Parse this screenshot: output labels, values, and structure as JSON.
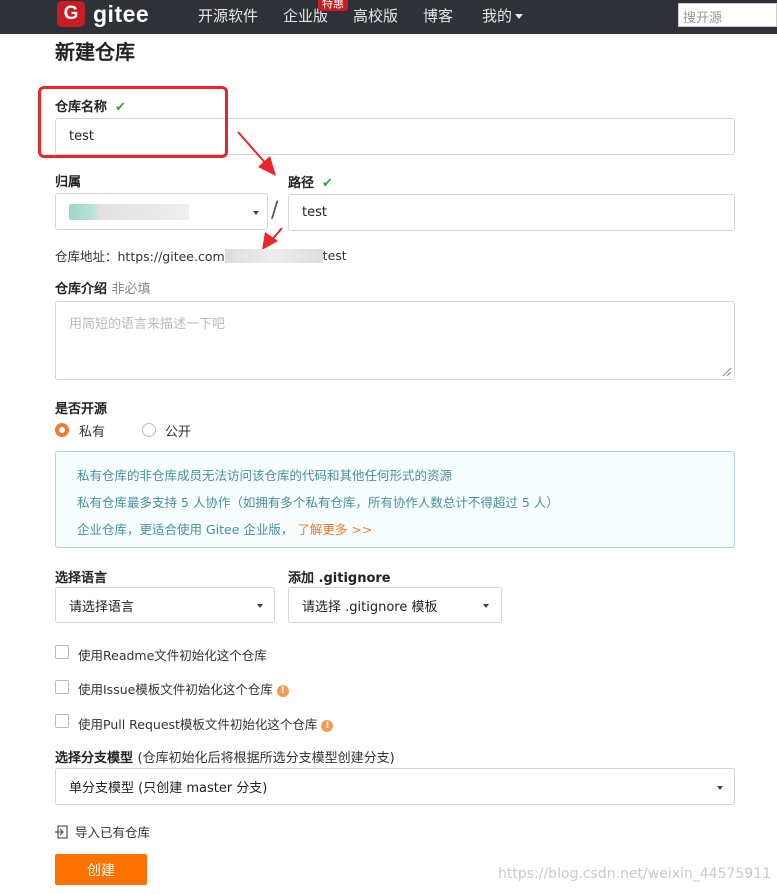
{
  "nav": {
    "logo_mark": "G",
    "logo_text": "gitee",
    "items": [
      "开源软件",
      "企业版",
      "高校版",
      "博客",
      "我的"
    ],
    "hot_badge": "特惠",
    "search_placeholder": "搜开源"
  },
  "page": {
    "title": "新建仓库",
    "repo_name_label": "仓库名称",
    "repo_name_value": "test",
    "owner_label": "归属",
    "path_label": "路径",
    "path_value": "test",
    "slash": "/",
    "address_prefix": "仓库地址：https://gitee.com",
    "address_suffix": "test",
    "intro_label": "仓库介绍",
    "intro_optional": "非必填",
    "intro_placeholder": "用简短的语言来描述一下吧",
    "open_label": "是否开源",
    "radio_private": "私有",
    "radio_public": "公开",
    "info_lines": [
      "私有仓库的非仓库成员无法访问该仓库的代码和其他任何形式的资源",
      "私有仓库最多支持 5 人协作（如拥有多个私有仓库，所有协作人数总计不得超过 5 人）",
      "企业仓库，更适合使用 Gitee 企业版，"
    ],
    "info_link": "了解更多 >>",
    "lang_label": "选择语言",
    "lang_value": "请选择语言",
    "gitignore_label": "添加 .gitignore",
    "gitignore_value": "请选择 .gitignore 模板",
    "checkbox_readme": "使用Readme文件初始化这个仓库",
    "checkbox_issue": "使用Issue模板文件初始化这个仓库",
    "checkbox_pr": "使用Pull Request模板文件初始化这个仓库",
    "branch_label": "选择分支模型",
    "branch_hint": "(仓库初始化后将根据所选分支模型创建分支)",
    "branch_value": "单分支模型 (只创建 master 分支)",
    "import_link": "导入已有仓库",
    "create_button": "创建",
    "watermark": "https://blog.csdn.net/weixin_44575911"
  },
  "colors": {
    "nav_bg": "#2f3138",
    "accent": "#fe7300",
    "annotation_red": "#e8262b",
    "check_green": "#3ea03e"
  }
}
